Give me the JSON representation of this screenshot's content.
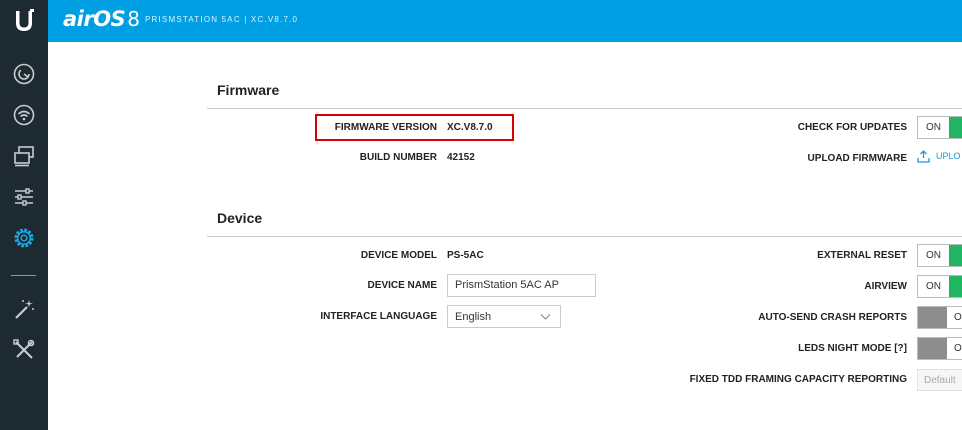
{
  "header": {
    "brand": "airOS",
    "brand_version": "8",
    "subtitle": "PRISMSTATION 5AC | XC.V8.7.0"
  },
  "sidebar": {
    "items": [
      {
        "name": "dashboard",
        "icon": "gauge-icon"
      },
      {
        "name": "wireless",
        "icon": "wifi-icon"
      },
      {
        "name": "network",
        "icon": "network-icon"
      },
      {
        "name": "services",
        "icon": "sliders-icon"
      },
      {
        "name": "system",
        "icon": "gear-icon",
        "active": true
      },
      {
        "name": "tools-wand",
        "icon": "magic-wand-icon"
      },
      {
        "name": "tools",
        "icon": "tools-icon"
      }
    ]
  },
  "colors": {
    "header": "#009ee3",
    "sidebar": "#1e2a31",
    "active_icon": "#1aa6e9",
    "toggle_on": "#1fb762",
    "toggle_off": "#8d8d8d",
    "highlight": "#d60000"
  },
  "firmware": {
    "title": "Firmware",
    "version_label": "FIRMWARE VERSION",
    "version_value": "XC.V8.7.0",
    "build_label": "BUILD NUMBER",
    "build_value": "42152",
    "check_label": "CHECK FOR UPDATES",
    "check_state": "ON",
    "upload_label": "UPLOAD FIRMWARE",
    "upload_link": "UPLO"
  },
  "device": {
    "title": "Device",
    "model_label": "DEVICE MODEL",
    "model_value": "PS-5AC",
    "name_label": "DEVICE NAME",
    "name_value": "PrismStation 5AC AP",
    "language_label": "INTERFACE LANGUAGE",
    "language_value": "English",
    "external_reset_label": "EXTERNAL RESET",
    "external_reset_state": "ON",
    "airview_label": "AIRVIEW",
    "airview_state": "ON",
    "crash_label": "AUTO-SEND CRASH REPORTS",
    "crash_state": "O",
    "leds_label": "LEDS NIGHT MODE [?]",
    "leds_state": "O",
    "tdd_label": "FIXED TDD FRAMING CAPACITY REPORTING",
    "tdd_placeholder": "Default"
  }
}
